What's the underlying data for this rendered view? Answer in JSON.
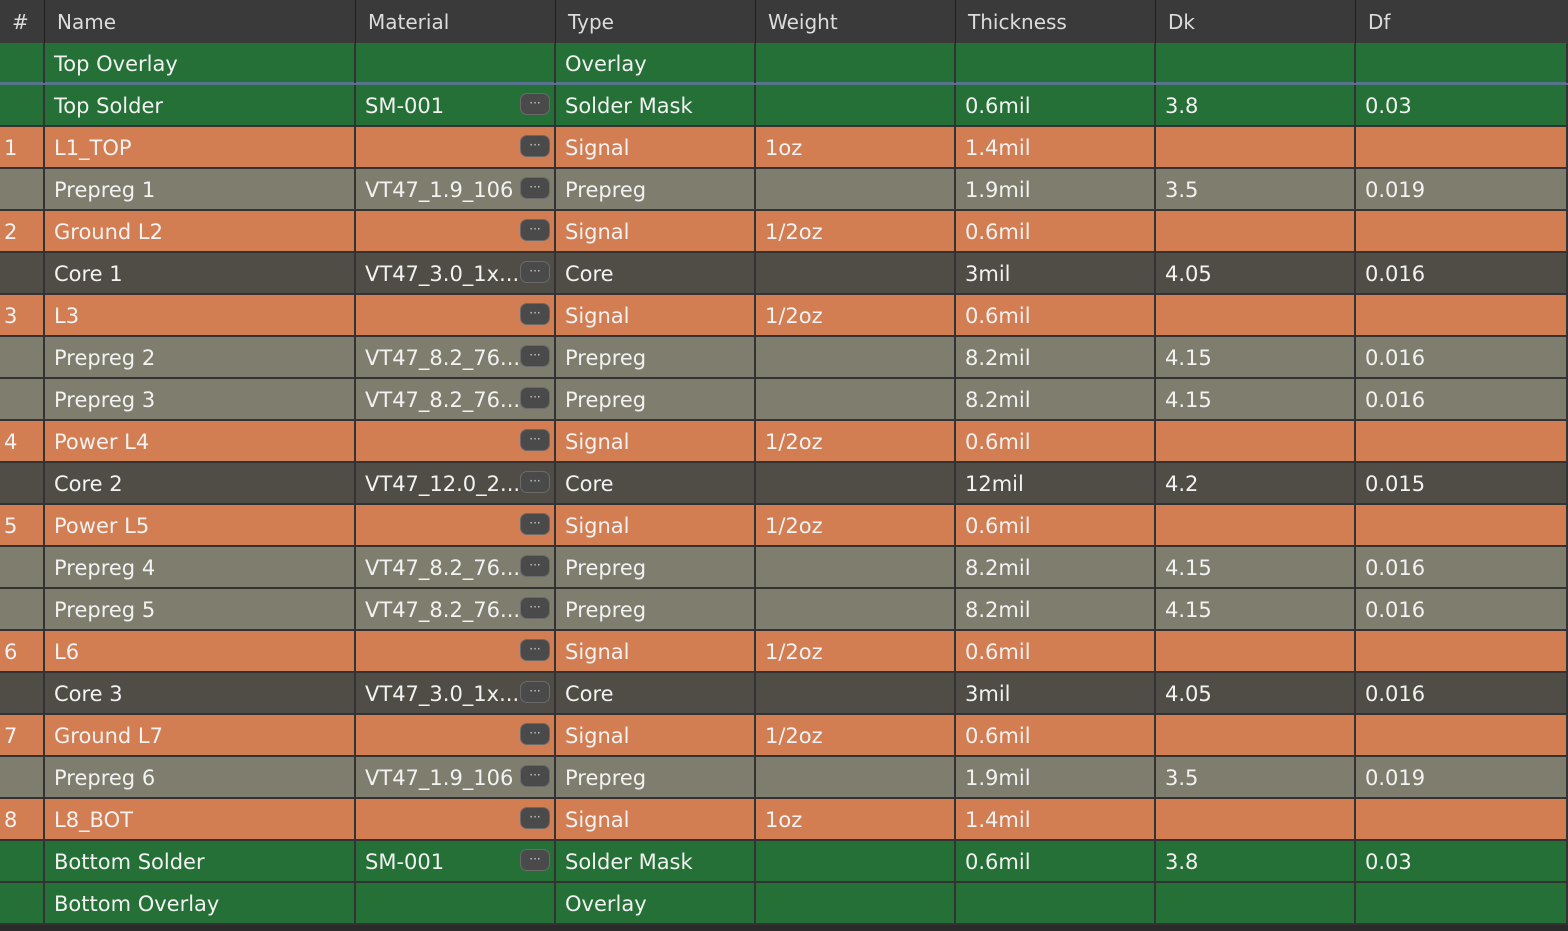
{
  "columns": [
    "#",
    "Name",
    "Material",
    "Type",
    "Weight",
    "Thickness",
    "Dk",
    "Df"
  ],
  "material_button_label": "···",
  "colors": {
    "overlay": "#247036",
    "solder_mask": "#247036",
    "signal": "#d27d52",
    "prepreg": "#7f7d6d",
    "core": "#4f4d45",
    "header": "#3a3a3a",
    "accent_line": "#55728f"
  },
  "rows": [
    {
      "num": "",
      "name": "Top Overlay",
      "material": "",
      "type": "Overlay",
      "weight": "",
      "thickness": "",
      "dk": "",
      "df": "",
      "kind": "overlay",
      "has_button": false
    },
    {
      "num": "",
      "name": "Top Solder",
      "material": "SM-001",
      "type": "Solder Mask",
      "weight": "",
      "thickness": "0.6mil",
      "dk": "3.8",
      "df": "0.03",
      "kind": "soldermask",
      "has_button": true
    },
    {
      "num": "1",
      "name": "L1_TOP",
      "material": "",
      "type": "Signal",
      "weight": "1oz",
      "thickness": "1.4mil",
      "dk": "",
      "df": "",
      "kind": "signal",
      "has_button": true
    },
    {
      "num": "",
      "name": "Prepreg 1",
      "material": "VT47_1.9_106",
      "type": "Prepreg",
      "weight": "",
      "thickness": "1.9mil",
      "dk": "3.5",
      "df": "0.019",
      "kind": "prepreg",
      "has_button": true
    },
    {
      "num": "2",
      "name": "Ground L2",
      "material": "",
      "type": "Signal",
      "weight": "1/2oz",
      "thickness": "0.6mil",
      "dk": "",
      "df": "",
      "kind": "signal",
      "has_button": true
    },
    {
      "num": "",
      "name": "Core 1",
      "material": "VT47_3.0_1x...",
      "type": "Core",
      "weight": "",
      "thickness": "3mil",
      "dk": "4.05",
      "df": "0.016",
      "kind": "core",
      "has_button": true
    },
    {
      "num": "3",
      "name": "L3",
      "material": "",
      "type": "Signal",
      "weight": "1/2oz",
      "thickness": "0.6mil",
      "dk": "",
      "df": "",
      "kind": "signal",
      "has_button": true
    },
    {
      "num": "",
      "name": "Prepreg 2",
      "material": "VT47_8.2_76...",
      "type": "Prepreg",
      "weight": "",
      "thickness": "8.2mil",
      "dk": "4.15",
      "df": "0.016",
      "kind": "prepreg",
      "has_button": true
    },
    {
      "num": "",
      "name": "Prepreg 3",
      "material": "VT47_8.2_76...",
      "type": "Prepreg",
      "weight": "",
      "thickness": "8.2mil",
      "dk": "4.15",
      "df": "0.016",
      "kind": "prepreg",
      "has_button": true
    },
    {
      "num": "4",
      "name": "Power L4",
      "material": "",
      "type": "Signal",
      "weight": "1/2oz",
      "thickness": "0.6mil",
      "dk": "",
      "df": "",
      "kind": "signal",
      "has_button": true
    },
    {
      "num": "",
      "name": "Core 2",
      "material": "VT47_12.0_2...",
      "type": "Core",
      "weight": "",
      "thickness": "12mil",
      "dk": "4.2",
      "df": "0.015",
      "kind": "core",
      "has_button": true
    },
    {
      "num": "5",
      "name": "Power L5",
      "material": "",
      "type": "Signal",
      "weight": "1/2oz",
      "thickness": "0.6mil",
      "dk": "",
      "df": "",
      "kind": "signal",
      "has_button": true
    },
    {
      "num": "",
      "name": "Prepreg 4",
      "material": "VT47_8.2_76...",
      "type": "Prepreg",
      "weight": "",
      "thickness": "8.2mil",
      "dk": "4.15",
      "df": "0.016",
      "kind": "prepreg",
      "has_button": true
    },
    {
      "num": "",
      "name": "Prepreg 5",
      "material": "VT47_8.2_76...",
      "type": "Prepreg",
      "weight": "",
      "thickness": "8.2mil",
      "dk": "4.15",
      "df": "0.016",
      "kind": "prepreg",
      "has_button": true
    },
    {
      "num": "6",
      "name": "L6",
      "material": "",
      "type": "Signal",
      "weight": "1/2oz",
      "thickness": "0.6mil",
      "dk": "",
      "df": "",
      "kind": "signal",
      "has_button": true
    },
    {
      "num": "",
      "name": "Core 3",
      "material": "VT47_3.0_1x...",
      "type": "Core",
      "weight": "",
      "thickness": "3mil",
      "dk": "4.05",
      "df": "0.016",
      "kind": "core",
      "has_button": true
    },
    {
      "num": "7",
      "name": "Ground L7",
      "material": "",
      "type": "Signal",
      "weight": "1/2oz",
      "thickness": "0.6mil",
      "dk": "",
      "df": "",
      "kind": "signal",
      "has_button": true
    },
    {
      "num": "",
      "name": "Prepreg 6",
      "material": "VT47_1.9_106",
      "type": "Prepreg",
      "weight": "",
      "thickness": "1.9mil",
      "dk": "3.5",
      "df": "0.019",
      "kind": "prepreg",
      "has_button": true
    },
    {
      "num": "8",
      "name": "L8_BOT",
      "material": "",
      "type": "Signal",
      "weight": "1oz",
      "thickness": "1.4mil",
      "dk": "",
      "df": "",
      "kind": "signal",
      "has_button": true
    },
    {
      "num": "",
      "name": "Bottom Solder",
      "material": "SM-001",
      "type": "Solder Mask",
      "weight": "",
      "thickness": "0.6mil",
      "dk": "3.8",
      "df": "0.03",
      "kind": "soldermask",
      "has_button": true
    },
    {
      "num": "",
      "name": "Bottom Overlay",
      "material": "",
      "type": "Overlay",
      "weight": "",
      "thickness": "",
      "dk": "",
      "df": "",
      "kind": "overlay",
      "has_button": false
    }
  ]
}
